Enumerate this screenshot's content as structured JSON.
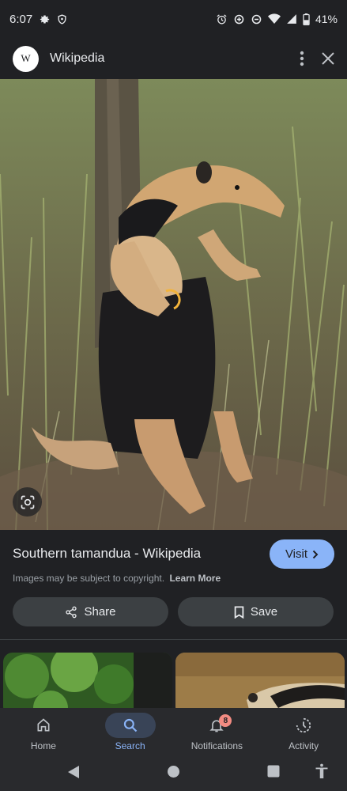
{
  "status_bar": {
    "time": "6:07",
    "battery": "41%"
  },
  "header": {
    "logo_letter": "W",
    "site_name": "Wikipedia",
    "icons": [
      "more-vert-icon",
      "close-icon"
    ]
  },
  "image": {
    "description_icon": "google-lens-icon"
  },
  "info": {
    "title": "Southern tamandua - Wikipedia",
    "visit_label": "Visit",
    "copyright_text": "Images may be subject to copyright.",
    "learn_more": "Learn More",
    "share_label": "Share",
    "save_label": "Save"
  },
  "bottom_nav": {
    "items": [
      {
        "label": "Home",
        "icon": "home-icon"
      },
      {
        "label": "Search",
        "icon": "search-icon",
        "active": true
      },
      {
        "label": "Notifications",
        "icon": "bell-icon",
        "badge": "8"
      },
      {
        "label": "Activity",
        "icon": "activity-icon"
      }
    ]
  },
  "colors": {
    "background": "#202124",
    "accent": "#8ab4f8",
    "button": "#3c4043",
    "badge": "#f28b82"
  }
}
